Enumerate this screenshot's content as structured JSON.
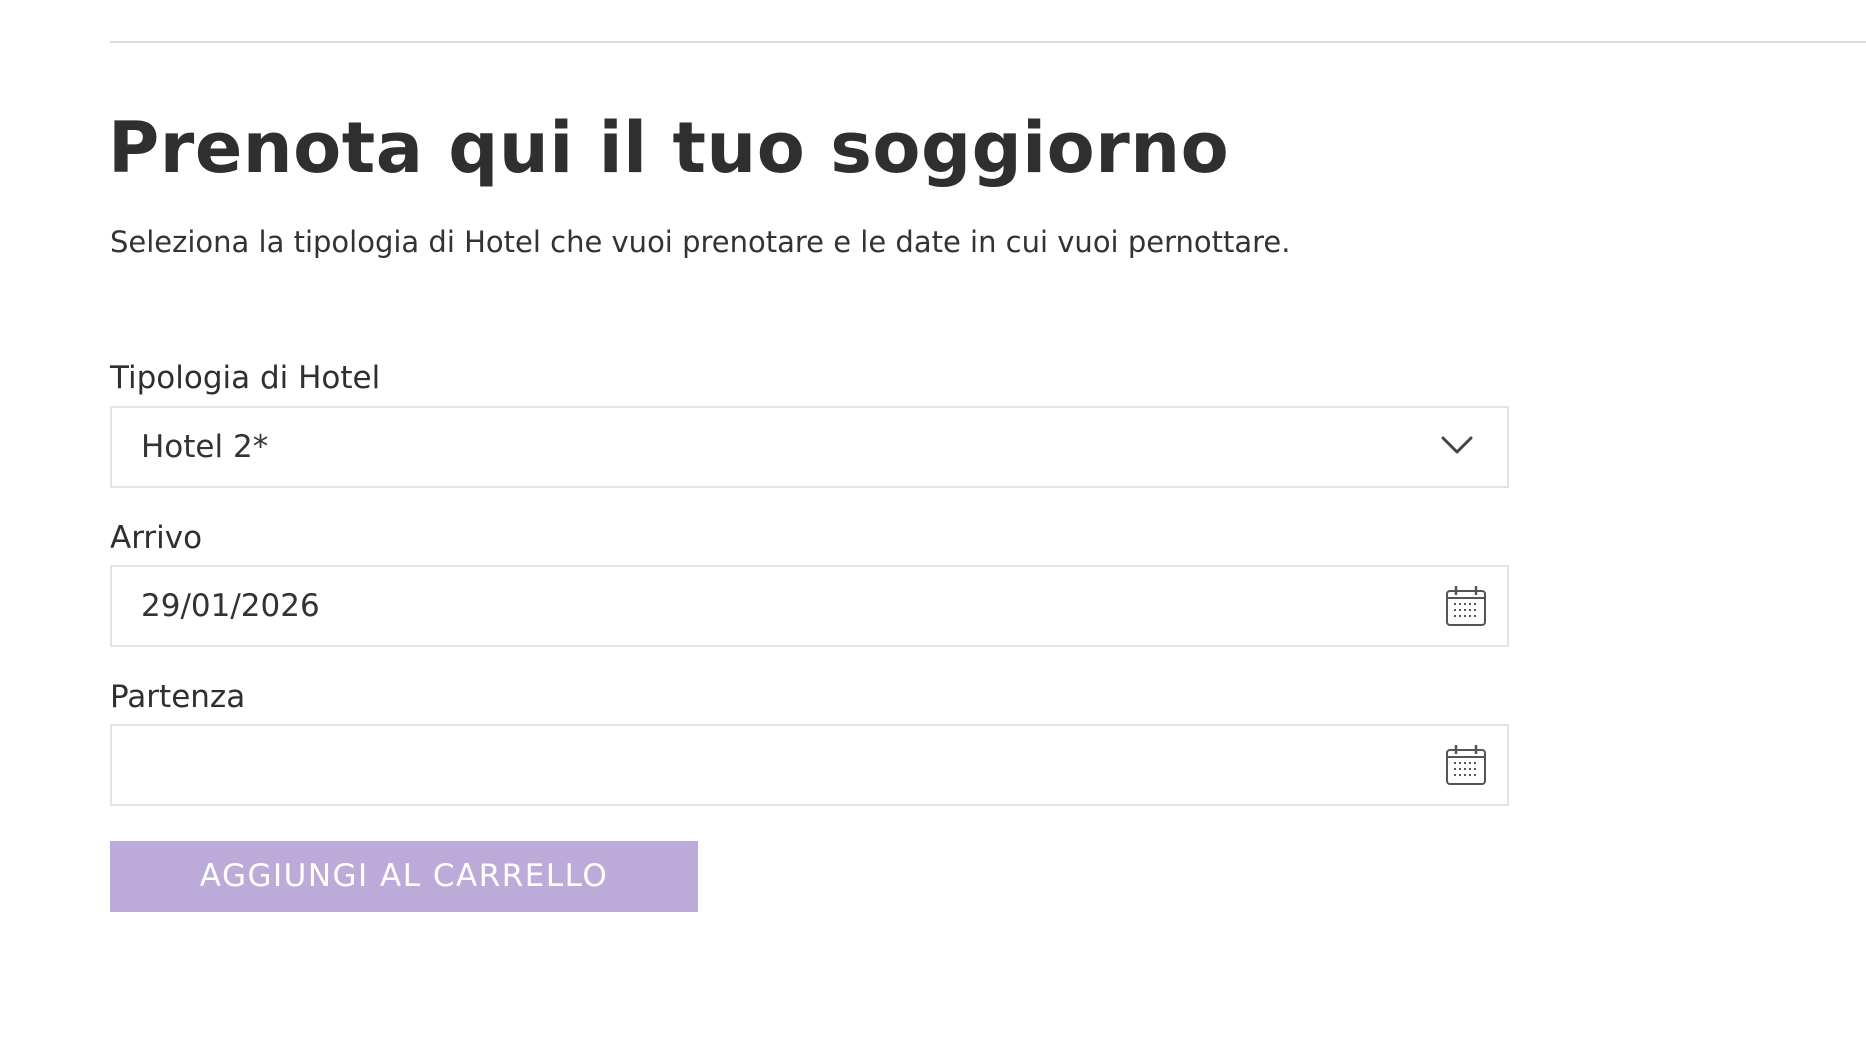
{
  "page": {
    "title": "Prenota qui il tuo soggiorno",
    "subtitle": "Seleziona la tipologia di Hotel che vuoi prenotare e le date in cui vuoi pernottare."
  },
  "form": {
    "hotel_type": {
      "label": "Tipologia di Hotel",
      "selected": "Hotel 2*",
      "icon": "chevron-down-icon"
    },
    "arrival": {
      "label": "Arrivo",
      "value": "29/01/2026",
      "icon": "calendar-icon"
    },
    "departure": {
      "label": "Partenza",
      "value": "",
      "icon": "calendar-icon"
    },
    "submit_label": "AGGIUNGI AL CARRELLO"
  },
  "colors": {
    "button_bg": "#bcaad9",
    "text": "#333333",
    "border": "#e4e4e4"
  }
}
